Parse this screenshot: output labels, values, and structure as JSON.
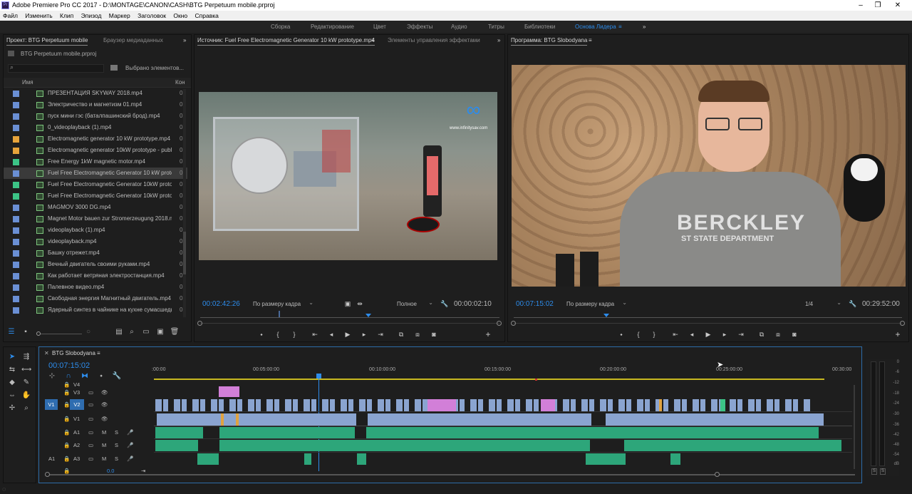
{
  "titlebar": {
    "text": "Adobe Premiere Pro CC 2017 - D:\\MONTAGE\\CANON\\CASH\\BTG Perpetuum mobile.prproj"
  },
  "menu": [
    "Файл",
    "Изменить",
    "Клип",
    "Эпизод",
    "Маркер",
    "Заголовок",
    "Окно",
    "Справка"
  ],
  "workspaces": [
    "Сборка",
    "Редактирование",
    "Цвет",
    "Эффекты",
    "Аудио",
    "Титры",
    "Библиотеки",
    "Основа Лидера"
  ],
  "project": {
    "tab1": "Проект: BTG Perpetuum mobile",
    "tab2": "Браузер медиаданных",
    "file": "BTG Perpetuum mobile.prproj",
    "selected_label": "Выбрано элементов...",
    "col_name": "Имя",
    "col_2": "Кон",
    "items": [
      {
        "name": "ПРЕЗЕНТАЦИЯ SKYWAY 2018.mp4",
        "color": "#6a8fd4",
        "v": "0"
      },
      {
        "name": "Электричество и магнетизм 01.mp4",
        "color": "#6a8fd4",
        "v": "0"
      },
      {
        "name": "пуск мини гэс (баталпашинский брод).mp4",
        "color": "#6a8fd4",
        "v": "0"
      },
      {
        "name": "0_videoplayback (1).mp4",
        "color": "#6a8fd4",
        "v": "0"
      },
      {
        "name": "Electromagnetic generator 10 kW prototype.mp4",
        "color": "#e6a33b",
        "v": "0"
      },
      {
        "name": "Electromagnetic generator 10kW prototype - publi",
        "color": "#e6a33b",
        "v": "0"
      },
      {
        "name": "Free Energy 1kW magnetic motor.mp4",
        "color": "#3cc486",
        "v": "0"
      },
      {
        "name": "Fuel Free Electromagnetic Generator 10 kW protot",
        "color": "#6a8fd4",
        "v": "0"
      },
      {
        "name": "Fuel Free Electromagnetic Generator 10kW prototy",
        "color": "#3cc486",
        "v": "0"
      },
      {
        "name": "Fuel Free Electromagnetic Generator 10kW prototy",
        "color": "#3cc486",
        "v": "0"
      },
      {
        "name": "MAGMOV 3000 DG.mp4",
        "color": "#6a8fd4",
        "v": "0"
      },
      {
        "name": "Magnet Motor bauen zur Stromerzeugung 2018.mp",
        "color": "#6a8fd4",
        "v": "0"
      },
      {
        "name": "videoplayback (1).mp4",
        "color": "#6a8fd4",
        "v": "0"
      },
      {
        "name": "videoplayback.mp4",
        "color": "#6a8fd4",
        "v": "0"
      },
      {
        "name": "Башку отрежет.mp4",
        "color": "#6a8fd4",
        "v": "0"
      },
      {
        "name": "Вечный двигатель своими руками.mp4",
        "color": "#6a8fd4",
        "v": "0"
      },
      {
        "name": "Как работает ветряная электростанция.mp4",
        "color": "#6a8fd4",
        "v": "0"
      },
      {
        "name": "Палевное видео.mp4",
        "color": "#6a8fd4",
        "v": "0"
      },
      {
        "name": "Свободная энергия Магнитный двигатель.mp4",
        "color": "#6a8fd4",
        "v": "0"
      },
      {
        "name": "Ядерный синтез в чайнике на кухне сумасшедший",
        "color": "#6a8fd4",
        "v": "0"
      }
    ]
  },
  "source": {
    "tab1": "Источник: Fuel Free Electromagnetic Generator 10 kW prototype.mp4",
    "tab2": "Элементы управления эффектами",
    "timecode": "00:02:42:26",
    "fit": "По размеру кадра",
    "quality": "Полное",
    "duration": "00:00:02:10",
    "watermark": "www.infinitysav.com"
  },
  "program": {
    "tab": "Программа: BTG Slobodyana",
    "timecode": "00:07:15:02",
    "fit": "По размеру кадра",
    "quality": "1/4",
    "duration": "00:29:52:00",
    "shirt_text": "BERCKLEY",
    "shirt_sub": "ST STATE DEPARTMENT"
  },
  "timeline": {
    "tab": "BTG Slobodyana",
    "timecode": "00:07:15:02",
    "ruler": [
      ":00:00",
      "00:05:00:00",
      "00:10:00:00",
      "00:15:00:00",
      "00:20:00:00",
      "00:25:00:00",
      "00:30:00"
    ],
    "tracks": [
      {
        "label": "V4",
        "src": "",
        "tgt": ""
      },
      {
        "label": "V3",
        "src": "",
        "tgt": ""
      },
      {
        "label": "V2",
        "src": "V1",
        "tgt": "V2"
      },
      {
        "label": "V1",
        "src": "",
        "tgt": ""
      },
      {
        "label": "A1",
        "src": "",
        "tgt": ""
      },
      {
        "label": "A2",
        "src": "",
        "tgt": ""
      },
      {
        "label": "A3",
        "src": "A1",
        "tgt": ""
      }
    ],
    "master": "0.0",
    "meter_labels": [
      "0",
      "-6",
      "-12",
      "-18",
      "-24",
      "-30",
      "-36",
      "-42",
      "-48",
      "-54",
      "dB"
    ],
    "meter_s": "S"
  }
}
